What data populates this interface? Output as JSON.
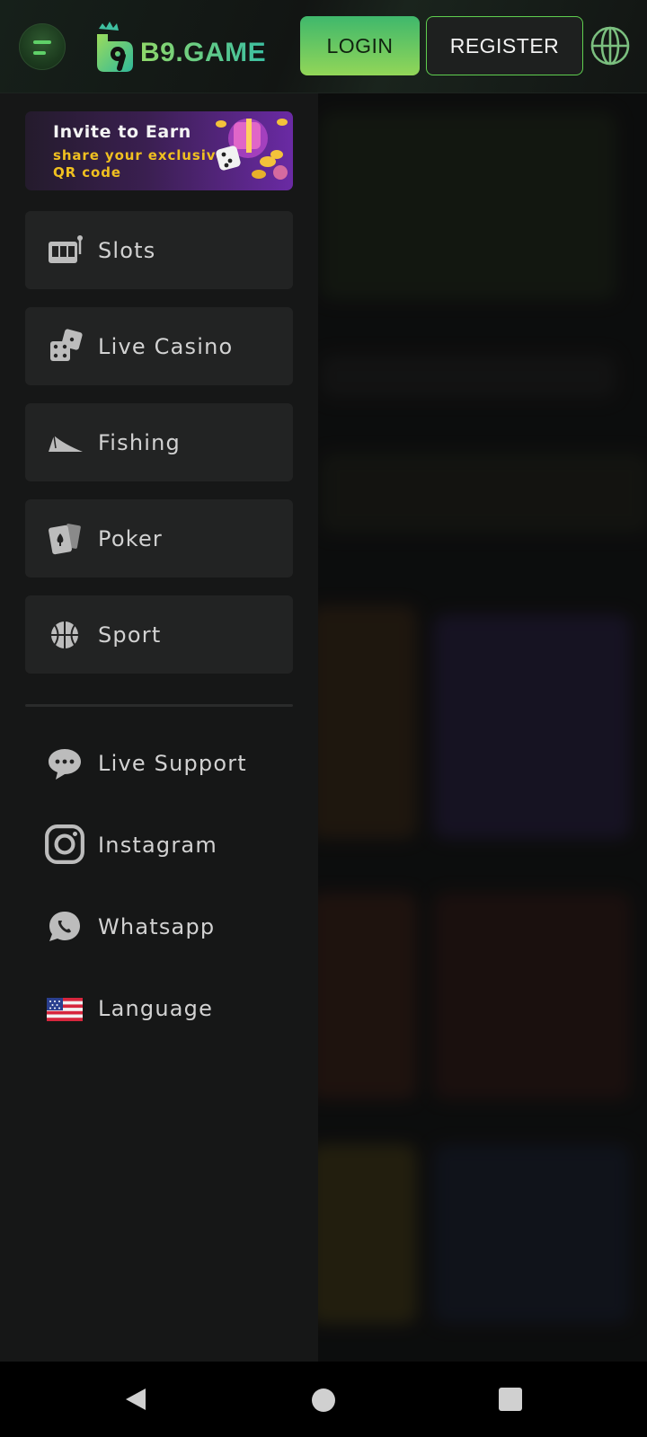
{
  "header": {
    "logo_text": "B9.GAME",
    "login_label": "LOGIN",
    "register_label": "REGISTER",
    "accent_green": "#5fcf4f"
  },
  "drawer": {
    "invite_banner": {
      "title": "Invite to Earn",
      "subtitle": "share your exclusive QR code"
    },
    "categories": [
      {
        "label": "Slots",
        "icon": "slot-machine-icon"
      },
      {
        "label": "Live Casino",
        "icon": "dice-icon"
      },
      {
        "label": "Fishing",
        "icon": "fish-icon"
      },
      {
        "label": "Poker",
        "icon": "playing-cards-icon"
      },
      {
        "label": "Sport",
        "icon": "basketball-icon"
      }
    ],
    "links": [
      {
        "label": "Live Support",
        "icon": "chat-bubble-icon"
      },
      {
        "label": "Instagram",
        "icon": "instagram-icon"
      },
      {
        "label": "Whatsapp",
        "icon": "whatsapp-icon"
      },
      {
        "label": "Language",
        "icon": "us-flag-icon"
      }
    ]
  },
  "system_nav": {
    "buttons": [
      "back",
      "home",
      "recents"
    ]
  }
}
